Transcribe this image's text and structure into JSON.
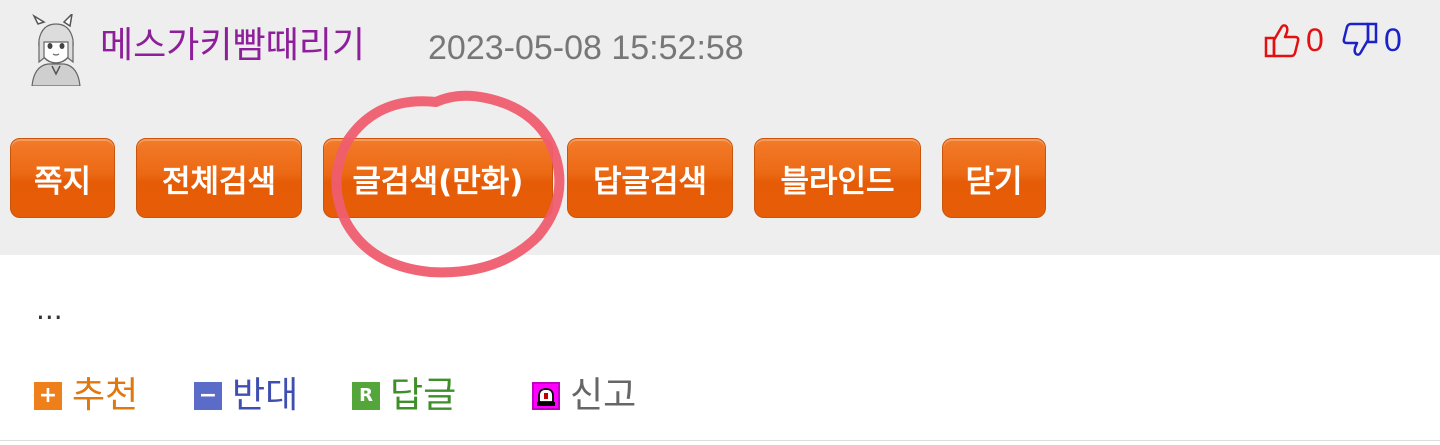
{
  "post": {
    "username": "메스가키빰때리기",
    "timestamp": "2023-05-08 15:52:58",
    "upvotes": "0",
    "downvotes": "0",
    "content": "..."
  },
  "buttons": {
    "message": "쪽지",
    "search_all": "전체검색",
    "search_posts_comic": "글검색(만화)",
    "search_replies": "답글검색",
    "blind": "블라인드",
    "close": "닫기"
  },
  "actions": {
    "recommend": {
      "badge": "+",
      "label": "추천"
    },
    "oppose": {
      "badge": "−",
      "label": "반대"
    },
    "reply": {
      "badge": "R",
      "label": "답글"
    },
    "report": {
      "label": "신고"
    }
  },
  "colors": {
    "username": "#8e1f9a",
    "button": "#ec6914",
    "upvote": "#e21010",
    "downvote": "#1a22c8",
    "annotation_circle": "#ef5d6e"
  },
  "icons": {
    "upvote": "thumbs-up-icon",
    "downvote": "thumbs-down-icon",
    "report": "siren-icon",
    "avatar": "anime-girl-avatar"
  }
}
